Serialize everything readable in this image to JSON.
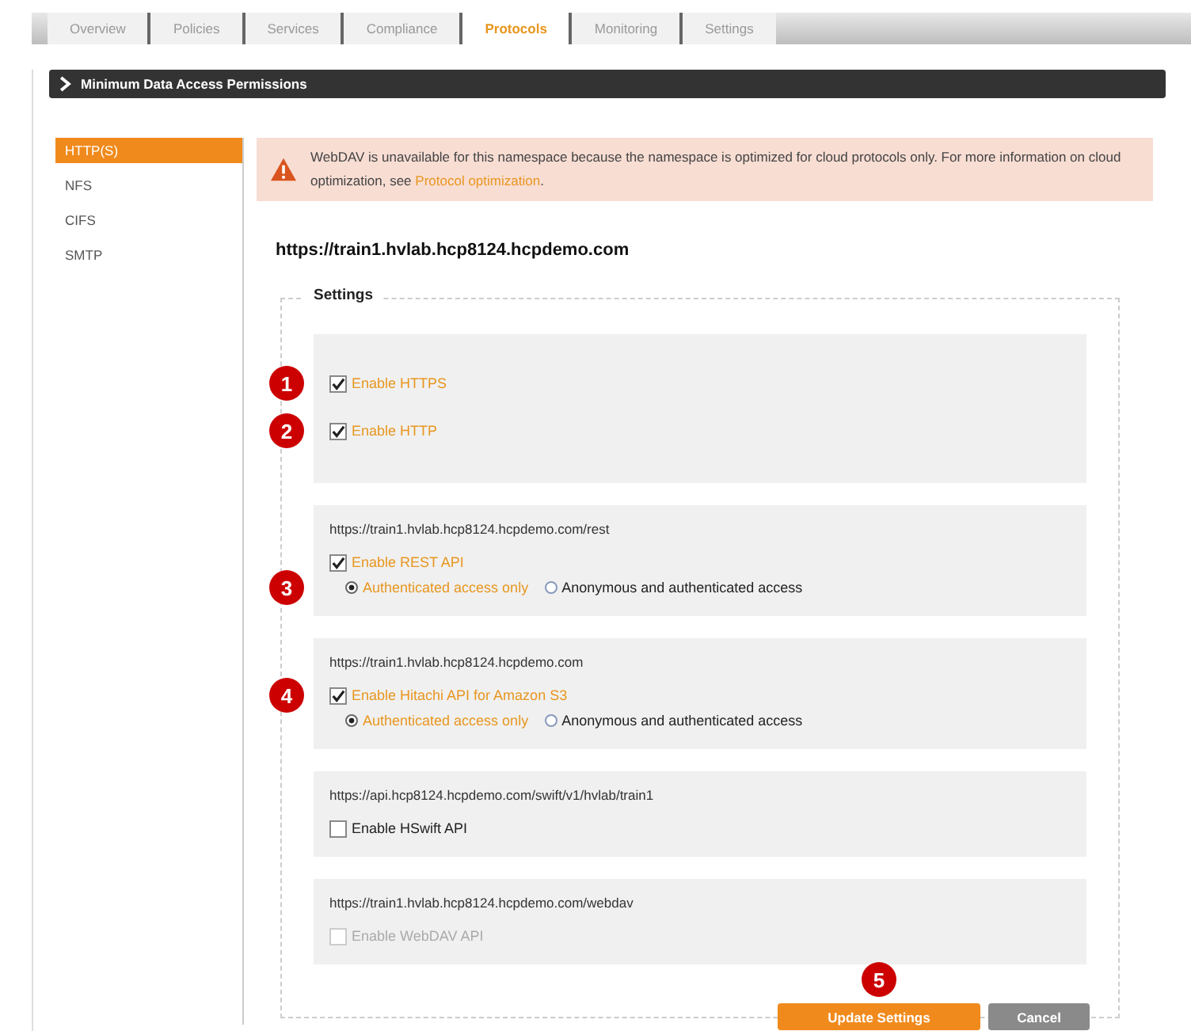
{
  "tabs": [
    {
      "label": "Overview",
      "selected": false
    },
    {
      "label": "Policies",
      "selected": false
    },
    {
      "label": "Services",
      "selected": false
    },
    {
      "label": "Compliance",
      "selected": false
    },
    {
      "label": "Protocols",
      "selected": true
    },
    {
      "label": "Monitoring",
      "selected": false
    },
    {
      "label": "Settings",
      "selected": false
    }
  ],
  "section_header": {
    "title": "Minimum Data Access Permissions"
  },
  "sidebar": {
    "items": [
      {
        "label": "HTTP(S)",
        "selected": true
      },
      {
        "label": "NFS",
        "selected": false
      },
      {
        "label": "CIFS",
        "selected": false
      },
      {
        "label": "SMTP",
        "selected": false
      }
    ]
  },
  "warning": {
    "text": "WebDAV is unavailable for this namespace because the namespace is optimized for cloud protocols only. For more information on cloud optimization, see ",
    "link": "Protocol optimization",
    "text_after": "."
  },
  "namespace_url": "https://train1.hvlab.hcp8124.hcpdemo.com",
  "settings": {
    "legend": "Settings",
    "groups": [
      {
        "rows": [
          {
            "kind": "checkbox",
            "label": "Enable HTTPS",
            "checked": true,
            "disabled": false,
            "callout": "1"
          },
          {
            "kind": "checkbox",
            "label": "Enable HTTP",
            "checked": true,
            "disabled": false,
            "callout": "2"
          }
        ]
      },
      {
        "url": "https://train1.hvlab.hcp8124.hcpdemo.com/rest",
        "rows": [
          {
            "kind": "checkbox",
            "label": "Enable REST API",
            "checked": true,
            "disabled": false
          },
          {
            "kind": "radio_group",
            "callout": "3",
            "options": [
              {
                "label": "Authenticated access only",
                "selected": true
              },
              {
                "label": "Anonymous and authenticated access",
                "selected": false
              }
            ]
          }
        ]
      },
      {
        "url": "https://train1.hvlab.hcp8124.hcpdemo.com",
        "rows": [
          {
            "kind": "checkbox",
            "label": "Enable Hitachi API for Amazon S3",
            "checked": true,
            "disabled": false,
            "callout": "4"
          },
          {
            "kind": "radio_group",
            "options": [
              {
                "label": "Authenticated access only",
                "selected": true
              },
              {
                "label": "Anonymous and authenticated access",
                "selected": false
              }
            ]
          }
        ]
      },
      {
        "url": "https://api.hcp8124.hcpdemo.com/swift/v1/hvlab/train1",
        "rows": [
          {
            "kind": "checkbox",
            "label": "Enable HSwift API",
            "checked": false,
            "disabled": false
          }
        ]
      },
      {
        "url": "https://train1.hvlab.hcp8124.hcpdemo.com/webdav",
        "rows": [
          {
            "kind": "checkbox",
            "label": "Enable WebDAV API",
            "checked": false,
            "disabled": true
          }
        ]
      }
    ]
  },
  "buttons": [
    {
      "label": "Update Settings",
      "kind": "primary",
      "callout": "5"
    },
    {
      "label": "Cancel",
      "kind": "secondary"
    }
  ]
}
